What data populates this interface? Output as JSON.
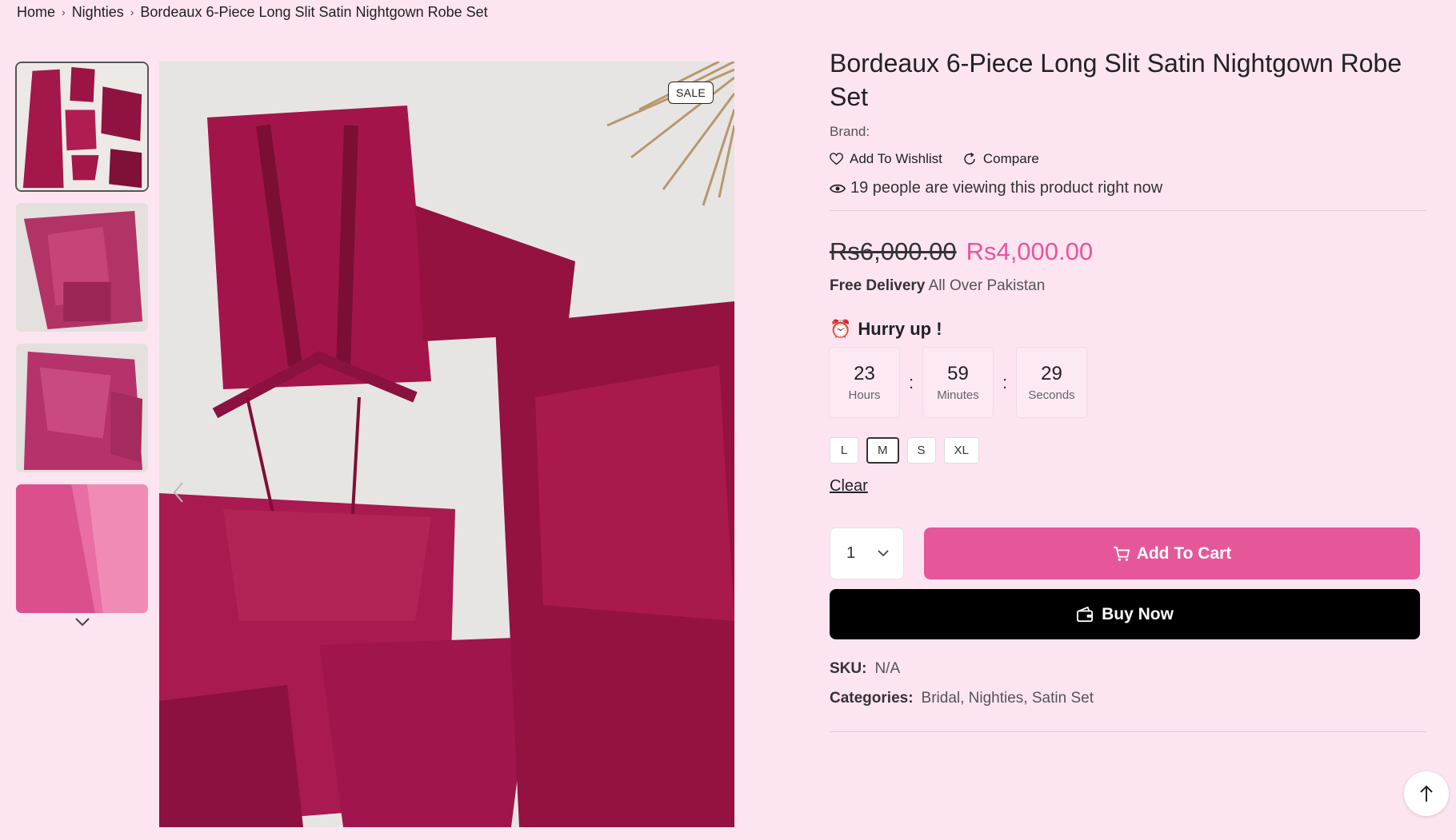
{
  "breadcrumb": {
    "items": [
      "Home",
      "Nighties"
    ],
    "current": "Bordeaux 6-Piece Long Slit Satin Nightgown Robe Set"
  },
  "gallery": {
    "sale_badge": "SALE",
    "thumbnail_count": 4,
    "active_thumbnail": 1
  },
  "product": {
    "title": "Bordeaux 6-Piece Long Slit Satin Nightgown Robe Set",
    "brand_label": "Brand:",
    "wishlist_label": "Add To Wishlist",
    "compare_label": "Compare",
    "viewing_text": "19 people are viewing this product right now",
    "old_price": "Rs6,000.00",
    "new_price": "Rs4,000.00",
    "delivery_bold": "Free Delivery",
    "delivery_rest": "All Over Pakistan",
    "hurry_text": "Hurry up !",
    "hurry_emoji": "⏰",
    "countdown": {
      "hours": "23",
      "hours_label": "Hours",
      "minutes": "59",
      "minutes_label": "Minutes",
      "seconds": "29",
      "seconds_label": "Seconds",
      "separator": ":"
    },
    "sizes": [
      "L",
      "M",
      "S",
      "XL"
    ],
    "selected_size": "M",
    "clear_label": "Clear",
    "quantity": "1",
    "add_to_cart_label": "Add To Cart",
    "buy_now_label": "Buy Now",
    "sku_label": "SKU:",
    "sku_value": "N/A",
    "categories_label": "Categories:",
    "categories_value": "Bridal, Nighties, Satin Set"
  },
  "colors": {
    "background": "#fde4f1",
    "accent_pink": "#e6579a",
    "price_pink": "#e9549a",
    "satin": "#9e1544"
  }
}
